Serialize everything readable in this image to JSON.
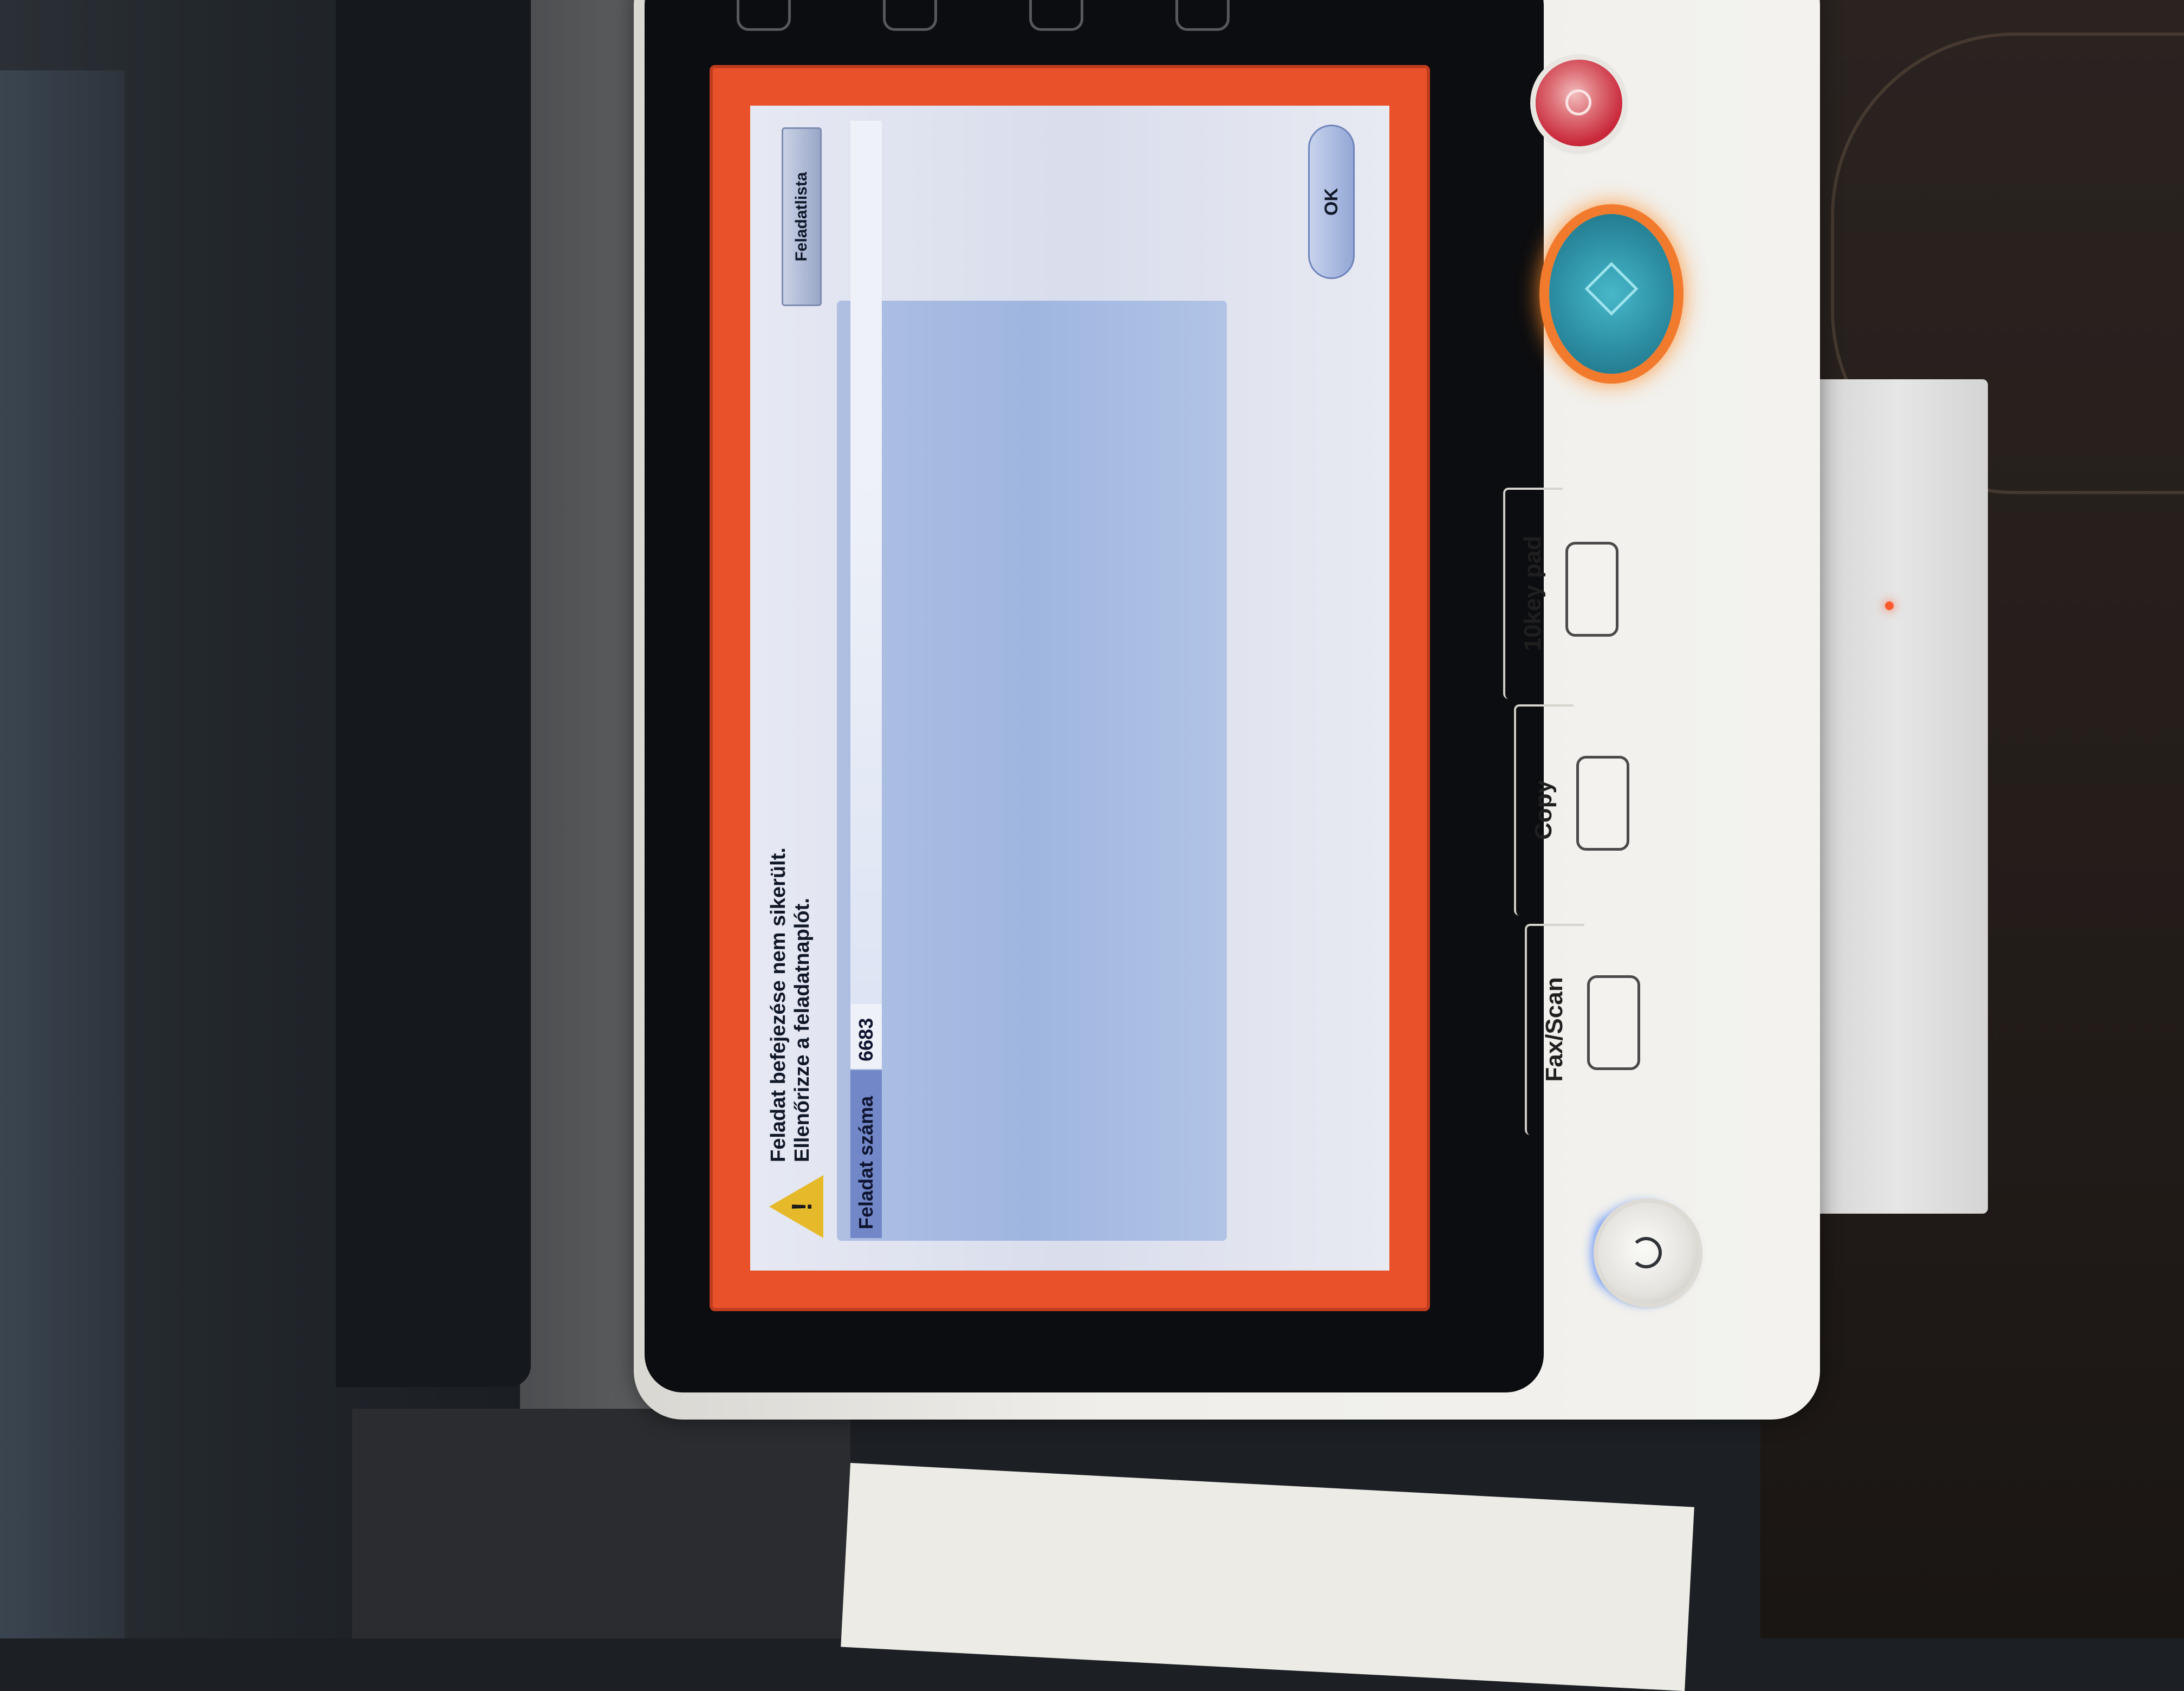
{
  "screen": {
    "message_line_1": "Feladat befejezése nem sikerült.",
    "message_line_2": "Ellenőrizze a feladatnaplót.",
    "job_number_label": "Feladat száma",
    "job_number_value": "6683",
    "job_list_button": "Feladatlista",
    "ok_button": "OK",
    "warning_icon": "warning-triangle-icon",
    "accent_color": "#e9512b"
  },
  "hardware": {
    "mode_keys": [
      "10key pad",
      "Copy",
      "Fax/Scan"
    ],
    "stop_icon": "stop-icon",
    "start_icon": "start-diamond-icon",
    "power_icon": "power-icon",
    "start_ring_color": "#f27a2d",
    "stop_color": "#c9283a"
  }
}
